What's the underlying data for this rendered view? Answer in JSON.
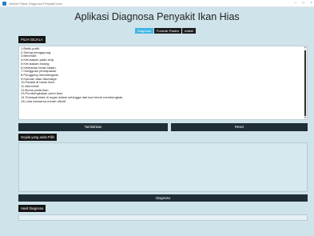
{
  "window": {
    "title": "Sistem Pakar Diagnosa Penyakit Ikan",
    "controls": [
      "–",
      "□",
      "×"
    ]
  },
  "app_title": "Aplikasi Diagnosa Penyakit Ikan Hias",
  "menu": {
    "items": [
      {
        "label": "Diagnosa",
        "active": true
      },
      {
        "label": "Formulir Pasien",
        "active": false
      },
      {
        "label": "Artikel",
        "active": false
      }
    ]
  },
  "symptoms": {
    "header": "PILIH GEJALA",
    "items": [
      "1.Bintik putih.",
      "2.Sering mengapung.",
      "3.Berlendir.",
      "4.Kerusakan pada sirip.",
      "5.Kerusakan insang.",
      "6.Kelelahan berat badan.",
      "7.Gangguan pernapasan.",
      "8.Punggung membengkak.",
      "9.Kotoran atau discharge.",
      "10.Parasit di tubuh ikan.",
      "11.Abnormal.",
      "12.Borok pada ikan.",
      "13.Pembengkakan perut ikan.",
      "14.Terdapat kista di organ dalam sehingga dari luar tubuh membengkak.",
      "15.Luka berwarna merah dikulit."
    ]
  },
  "buttons": {
    "add": "Tambahkan",
    "reset": "Reset",
    "diagnose": "Diagnosa"
  },
  "selected": {
    "header": "Gejala yang anda Pilih"
  },
  "result": {
    "header": "Hasil Diagnosa"
  }
}
